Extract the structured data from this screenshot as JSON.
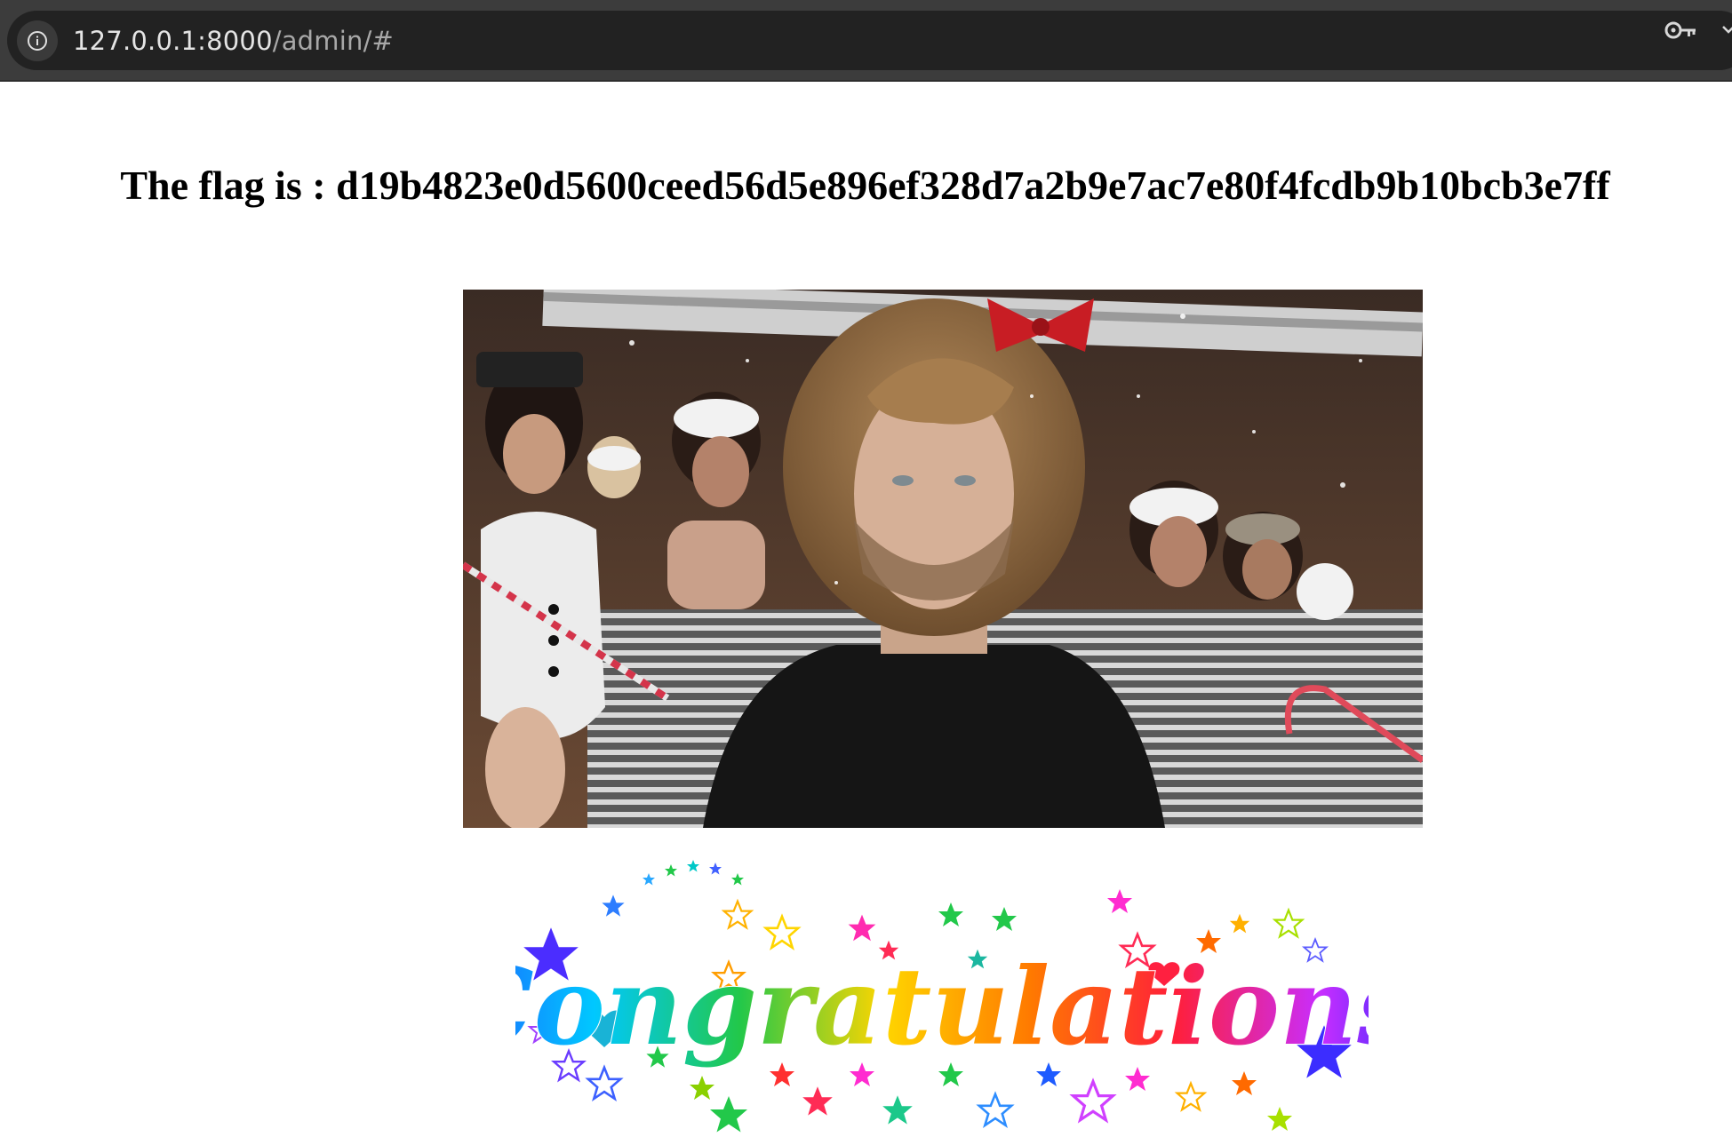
{
  "browser": {
    "url_host": "127.0.0.1:8000",
    "url_path": "/admin/#",
    "icons": {
      "site_info": "info-circle-icon",
      "password": "key-icon",
      "menu": "chevron-down-icon"
    }
  },
  "page": {
    "flag_text": "The flag is : d19b4823e0d5600ceed56d5e896ef328d7a2b9e7ac7e80f4fcdb9b10bcb3e7ff",
    "congrats_text": "Congratulations",
    "gif_description": "celebration-gif"
  },
  "colors": {
    "chrome_bg": "#3c3c3c",
    "omnibox_bg": "#222222",
    "url_text": "#e4e4e4",
    "page_bg": "#ffffff"
  }
}
